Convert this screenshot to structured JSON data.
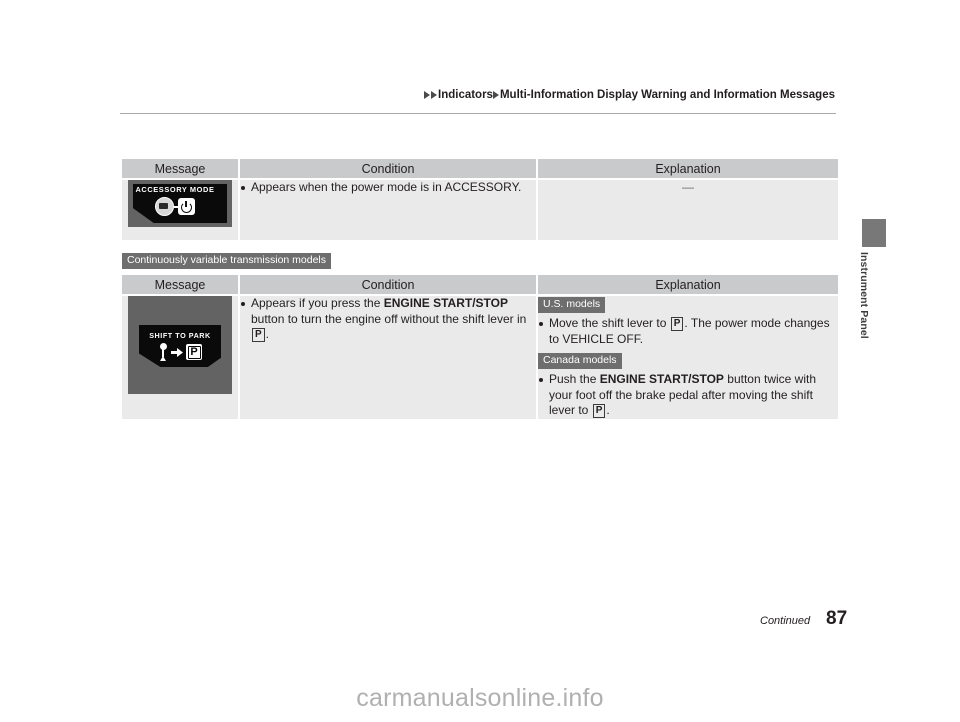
{
  "header": {
    "breadcrumb_part1": "Indicators",
    "breadcrumb_part2": "Multi-Information Display Warning and Information Messages"
  },
  "side_tab": {
    "label": "Instrument Panel"
  },
  "tables": [
    {
      "section_badge": null,
      "columns": [
        "Message",
        "Condition",
        "Explanation"
      ],
      "rows": [
        {
          "message_art": {
            "type": "accessory-mode-indicator",
            "text": "ACCESSORY MODE",
            "icons": [
              "engine-start-button-icon",
              "power-icon"
            ]
          },
          "condition_bullets": [
            "Appears when the power mode is in ACCESSORY."
          ],
          "explanation_dash": "—"
        }
      ]
    },
    {
      "section_badge": "Continuously variable transmission models",
      "columns": [
        "Message",
        "Condition",
        "Explanation"
      ],
      "rows": [
        {
          "message_art": {
            "type": "shift-to-park-indicator",
            "text": "SHIFT TO PARK",
            "icons": [
              "shift-lever-icon",
              "arrow-right-icon",
              "park-p-icon"
            ]
          },
          "condition": {
            "text_a": "Appears if you press the ",
            "bold_a": "ENGINE START/STOP",
            "text_b": " button to turn the engine off without the shift lever in ",
            "p_glyph": "P",
            "text_c": "."
          },
          "explanation_groups": [
            {
              "badge": "U.S. models",
              "text_a": "Move the shift lever to ",
              "p_glyph": "P",
              "text_b": ". The power mode changes to VEHICLE OFF."
            },
            {
              "badge": "Canada models",
              "text_a": "Push the ",
              "bold_a": "ENGINE START/STOP",
              "text_b": " button twice with your foot off the brake pedal after moving the shift lever to ",
              "p_glyph": "P",
              "text_c": "."
            }
          ]
        }
      ]
    }
  ],
  "footer": {
    "continued": "Continued",
    "page_number": "87",
    "watermark": "carmanualsonline.info"
  }
}
